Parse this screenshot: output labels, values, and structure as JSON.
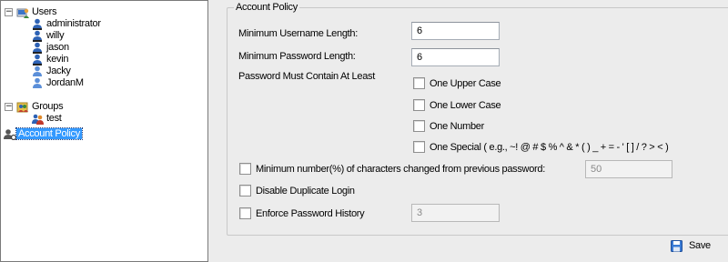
{
  "tree": {
    "users_label": "Users",
    "users": [
      "administrator",
      "willy",
      "jason",
      "kevin",
      "Jacky",
      "JordanM"
    ],
    "groups_label": "Groups",
    "groups": [
      "test"
    ],
    "policy_label": "Account Policy",
    "expander_symbol": "−"
  },
  "policy": {
    "legend": "Account Policy",
    "min_username_label": "Minimum Username Length:",
    "min_username_value": "6",
    "min_password_label": "Minimum Password Length:",
    "min_password_value": "6",
    "must_contain_label": "Password Must Contain At Least",
    "upper_label": "One Upper Case",
    "lower_label": "One Lower Case",
    "number_label": "One Number",
    "special_label": "One Special ( e.g., ~! @ # $ % ^ & * ( ) _ + = - ' [ ] / ? > < )",
    "min_changed_label": "Minimum number(%) of characters changed from previous password:",
    "min_changed_value": "50",
    "disable_dup_label": "Disable Duplicate Login",
    "enforce_history_label": "Enforce Password History",
    "enforce_history_value": "3"
  },
  "footer": {
    "save_label": "Save"
  },
  "colors": {
    "selection": "#3399ff",
    "user_icon": "#2d62b5",
    "save_icon": "#3a7bd5"
  }
}
